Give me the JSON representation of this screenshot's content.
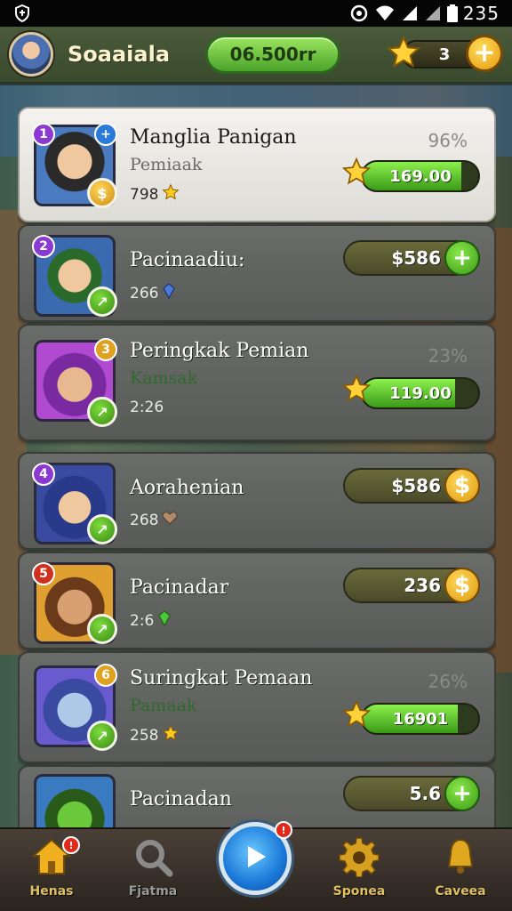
{
  "status_bar": {
    "time": "235",
    "left_icon": "shield-icon",
    "right_icons": [
      "target-icon",
      "wifi-icon",
      "signal-icon",
      "signal-icon",
      "battery-icon"
    ]
  },
  "header": {
    "player_name": "Soaaiala",
    "coins": "06.500rr",
    "stars": "3",
    "plus_label": "+"
  },
  "cards": [
    {
      "title": "Manglia Panigan",
      "subtitle": "Pemiaak",
      "meta": "798",
      "meta_icon": "star-icon",
      "percent": "96%",
      "progress_value": "169.00",
      "progress_fraction": 0.85,
      "highlight": true,
      "portrait_color": "#4a7ac0"
    },
    {
      "title": "Pacinaadiu:",
      "meta": "266",
      "meta_icon": "gem-icon",
      "value": "$586",
      "button": "+",
      "button_color": "green",
      "portrait_color": "#3a6ab0"
    },
    {
      "title": "Peringkak Pemian",
      "subtitle": "Kamsak",
      "meta": "2:26",
      "percent": "23%",
      "progress_value": "119.00",
      "progress_fraction": 0.8,
      "portrait_color": "#b04ad0"
    },
    {
      "title": "Aorahenian",
      "meta": "268",
      "meta_icon": "heart-icon",
      "value": "$586",
      "button": "$",
      "button_color": "gold",
      "portrait_color": "#3a4aa0"
    },
    {
      "title": "Pacinadar",
      "meta": "2:6",
      "meta_icon": "gem-icon",
      "value": "236",
      "button": "$",
      "button_color": "gold",
      "portrait_color": "#e0a030"
    },
    {
      "title": "Suringkat Pemaan",
      "subtitle": "Pamaak",
      "meta": "258",
      "meta_icon": "star-icon",
      "percent": "26%",
      "progress_value": "16901",
      "progress_fraction": 0.82,
      "portrait_color": "#6a5ad0"
    },
    {
      "title": "Pacinadan",
      "value": "5.6",
      "button": "+",
      "button_color": "green",
      "portrait_color": "#3a7ac0"
    }
  ],
  "bottom_nav": {
    "items": [
      {
        "label": "Henas",
        "icon": "home-icon"
      },
      {
        "label": "Fjatma",
        "icon": "search-icon"
      },
      {
        "label": "Sponea",
        "icon": "gear-icon"
      },
      {
        "label": "Caveea",
        "icon": "bell-icon"
      }
    ],
    "center_icon": "play-icon"
  },
  "colors": {
    "accent_green": "#4aa32a",
    "accent_gold": "#e59b0e",
    "header_bg": "#4a5a3a",
    "card_bg": "#5f615f",
    "highlight_card_bg": "#ebe9e4"
  }
}
